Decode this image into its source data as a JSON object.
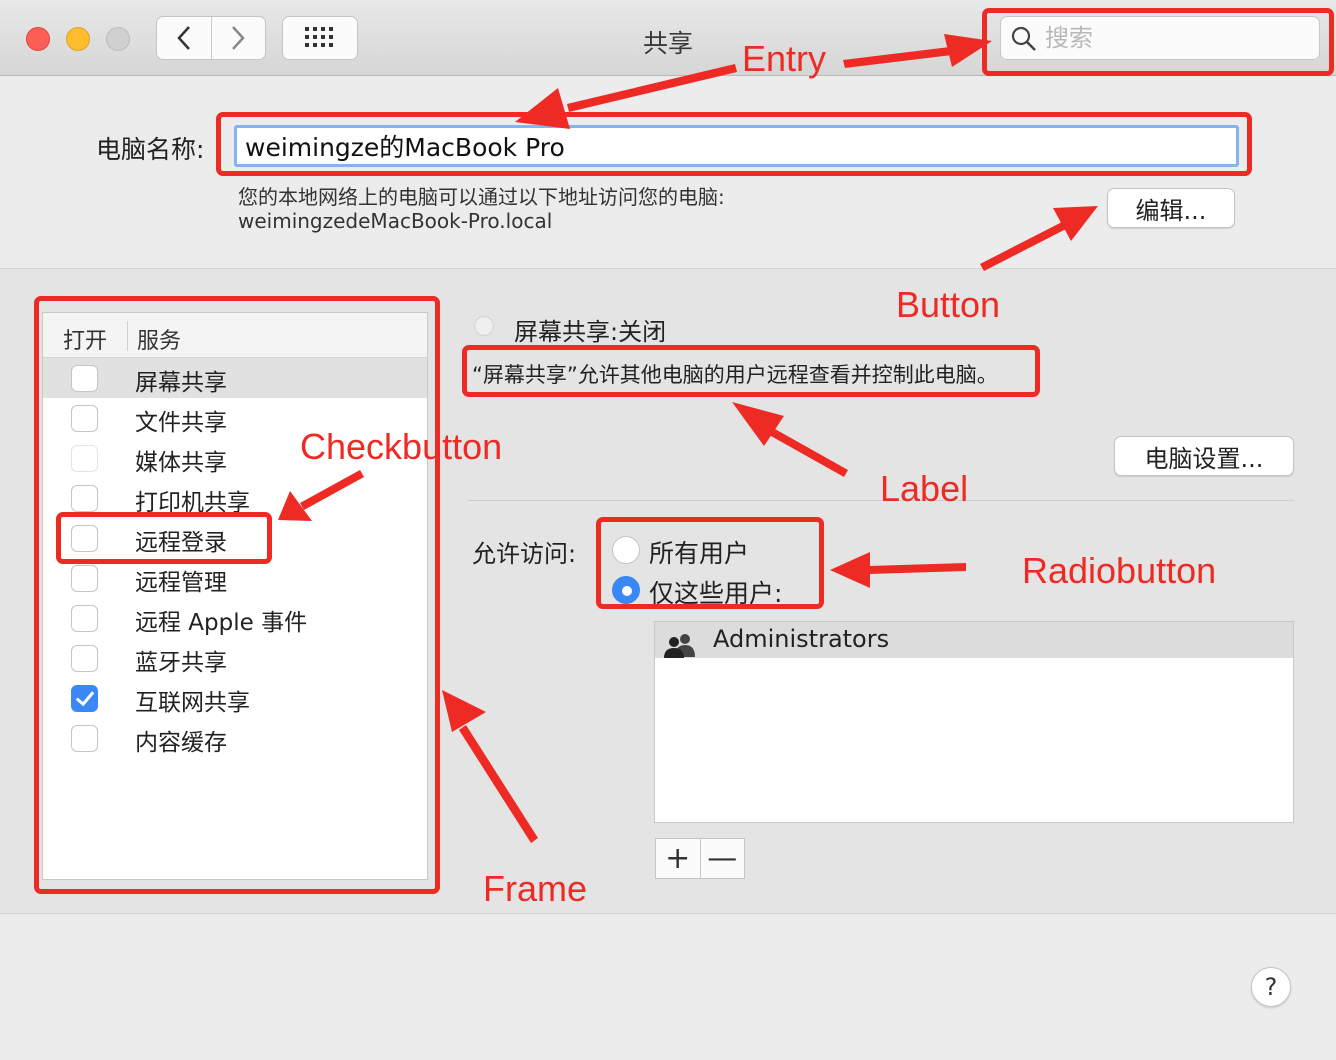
{
  "window": {
    "title": "共享",
    "search_placeholder": "搜索"
  },
  "computer_name": {
    "label": "电脑名称:",
    "value": "weimingze的MacBook Pro",
    "address_note": "您的本地网络上的电脑可以通过以下地址访问您的电脑:",
    "address": "weimingzedeMacBook-Pro.local",
    "edit_button": "编辑..."
  },
  "services": {
    "header_open": "打开",
    "header_service": "服务",
    "items": [
      {
        "label": "屏幕共享",
        "checked": false,
        "selected": true
      },
      {
        "label": "文件共享",
        "checked": false
      },
      {
        "label": "媒体共享",
        "checked": false
      },
      {
        "label": "打印机共享",
        "checked": false
      },
      {
        "label": "远程登录",
        "checked": false
      },
      {
        "label": "远程管理",
        "checked": false
      },
      {
        "label": "远程 Apple 事件",
        "checked": false
      },
      {
        "label": "蓝牙共享",
        "checked": false
      },
      {
        "label": "互联网共享",
        "checked": true
      },
      {
        "label": "内容缓存",
        "checked": false
      }
    ]
  },
  "detail": {
    "status": "屏幕共享:关闭",
    "description": "“屏幕共享”允许其他电脑的用户远程查看并控制此电脑。",
    "settings_button": "电脑设置...",
    "access_label": "允许访问:",
    "option_all": "所有用户",
    "option_some": "仅这些用户:",
    "selected_option": "仅这些用户:",
    "users": [
      "Administrators"
    ],
    "add_symbol": "+",
    "remove_symbol": "—"
  },
  "help_symbol": "?",
  "annotations": {
    "entry": "Entry",
    "button": "Button",
    "checkbutton": "Checkbutton",
    "label": "Label",
    "radiobutton": "Radiobutton",
    "frame": "Frame"
  },
  "colors": {
    "annotation": "#ee2a24",
    "accent": "#3b87f6",
    "field_focus": "#85b3ee"
  }
}
